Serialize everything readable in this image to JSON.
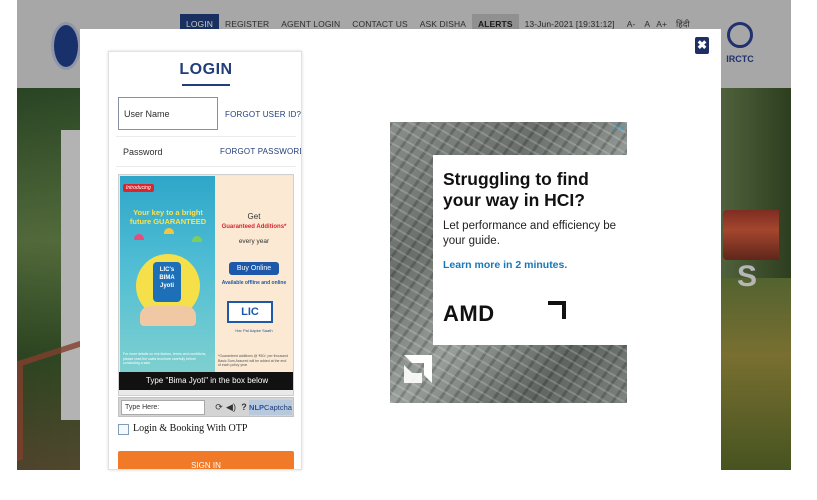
{
  "top_nav": {
    "items": [
      "LOGIN",
      "REGISTER",
      "AGENT LOGIN",
      "CONTACT US",
      "ASK DISHA",
      "ALERTS"
    ],
    "datetime": "13-Jun-2021 [19:31:12]",
    "font_controls": [
      "A-",
      "A",
      "A+"
    ],
    "language": "हिंदी"
  },
  "brand": {
    "right_logo_text": "IRCTC"
  },
  "hero": {
    "partial_letter": "S"
  },
  "login": {
    "title": "LOGIN",
    "username_placeholder": "User Name",
    "password_placeholder": "Password",
    "forgot_user": "FORGOT USER ID?",
    "forgot_password": "FORGOT PASSWORD?",
    "captcha": {
      "instruction": "Type \"Bima Jyoti\" in the box below",
      "input_placeholder": "Type Here:",
      "brand_prefix": "NLP",
      "brand_suffix": "Captcha"
    },
    "captcha_ad": {
      "badge": "Introducing",
      "tagline": "Your key to a bright future GUARANTEED",
      "product": "LIC's BIMA Jyoti",
      "get": "Get",
      "additions": "Guaranteed Additions*",
      "every_year": "every year",
      "buy_online": "Buy Online",
      "available": "Available offline and online",
      "lic_logo": "LIC",
      "lic_sub": "Har Pal Aapke Saath",
      "fine_print": "For more details on risk factors, terms and conditions, please read the sales brochure carefully before concluding a sale.",
      "right_fine_print": "*Guaranteed additions @ ₹50/- per thousand Basic Sum Assured will be added at the end of each policy year"
    },
    "otp_label": "Login & Booking With OTP",
    "sign_in": "SIGN IN"
  },
  "amd_ad": {
    "headline": "Struggling to find your way in HCI?",
    "body": "Let performance and efficiency be your guide.",
    "link": "Learn more in 2 minutes.",
    "logo": "AMD"
  },
  "colors": {
    "brand_blue": "#213d7a",
    "sign_in_orange": "#f07a27",
    "amd_link": "#1778b8"
  },
  "icons": {
    "close": "close-icon",
    "refresh": "refresh-icon",
    "audio": "speaker-icon",
    "help": "help-icon",
    "adchoices": "adchoices-icon"
  }
}
